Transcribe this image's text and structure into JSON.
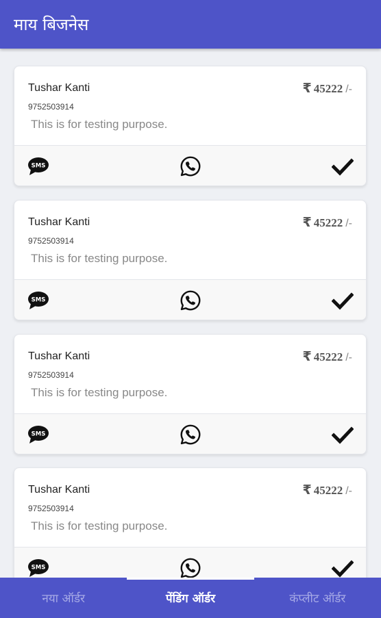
{
  "app": {
    "title": "माय बिजनेस"
  },
  "colors": {
    "primary": "#4e54c8",
    "inactive_tab": "#a7aae6"
  },
  "orders": [
    {
      "name": "Tushar Kanti",
      "phone": "9752503914",
      "note": "This is for testing purpose.",
      "currency": "₹",
      "amount": "45222",
      "suffix": "/-"
    },
    {
      "name": "Tushar Kanti",
      "phone": "9752503914",
      "note": "This is for testing purpose.",
      "currency": "₹",
      "amount": "45222",
      "suffix": "/-"
    },
    {
      "name": "Tushar Kanti",
      "phone": "9752503914",
      "note": "This is for testing purpose.",
      "currency": "₹",
      "amount": "45222",
      "suffix": "/-"
    },
    {
      "name": "Tushar Kanti",
      "phone": "9752503914",
      "note": "This is for testing purpose.",
      "currency": "₹",
      "amount": "45222",
      "suffix": "/-"
    }
  ],
  "actions": {
    "sms_icon": "sms-icon",
    "whatsapp_icon": "whatsapp-icon",
    "complete_icon": "checkmark-icon"
  },
  "tabs": [
    {
      "label": "नया ऑर्डर",
      "active": false
    },
    {
      "label": "पेंडिंग ऑर्डर",
      "active": true
    },
    {
      "label": "कंप्लीट ऑर्डर",
      "active": false
    }
  ]
}
